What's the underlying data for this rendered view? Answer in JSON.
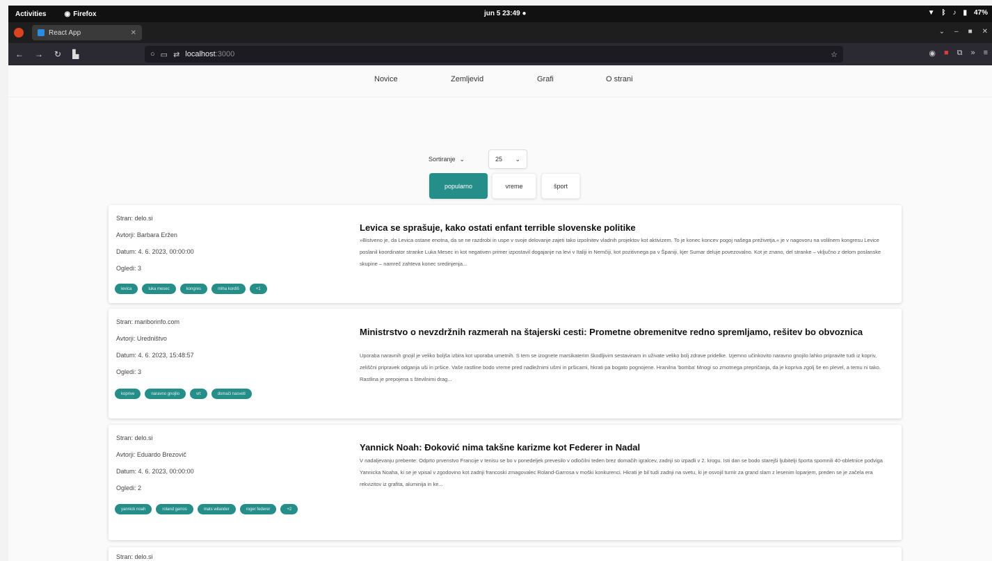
{
  "system": {
    "activities": "Activities",
    "app_name": "Firefox",
    "clock": "jun 5 23:49",
    "battery": "47%"
  },
  "browser": {
    "tab_title": "React App",
    "url_host": "localhost",
    "url_port": ":3000"
  },
  "nav": {
    "items": [
      "Novice",
      "Zemljevid",
      "Grafi",
      "O strani"
    ]
  },
  "controls": {
    "sort_label": "Sortiranje",
    "page_size": "25",
    "categories": [
      "popularno",
      "vreme",
      "šport"
    ]
  },
  "articles": [
    {
      "source": "Stran: delo.si",
      "author": "Avtorji: Barbara Eržen",
      "date": "Datum: 4. 6. 2023, 00:00:00",
      "views": "Ogledi: 3",
      "tags": [
        "levica",
        "luka mesec",
        "kongres",
        "miha kordiš",
        "+1"
      ],
      "title": "Levica se sprašuje, kako ostati enfant terrible slovenske politike",
      "summary": "»Bistveno je, da Levica ostane enotna, da se ne razdrobi in uspe v svoje delovanje zajeti tako izpolnitev vladnih projektov kot aktivizem. To je konec koncev pogoj našega preživetja.« je v nagovoru na volilnem kongresu Levice poslanil koordinator stranke Luka Mesec in kot negativen primer izpostavil dogajanje na levi v Italiji in Nemčiji, kot pozitivnega pa v Španiji, kjer Sumar deluje povezovalno. Kot je znano, del stranke – vključno z delom poslanske skupine – namreč zahteva konec sredinjenja..."
    },
    {
      "source": "Stran: mariborinfo.com",
      "author": "Avtorji: Uredništvo",
      "date": "Datum: 4. 6. 2023, 15:48:57",
      "views": "Ogledi: 3",
      "tags": [
        "koprive",
        "naravno gnojilo",
        "vrt",
        "domači nasveti"
      ],
      "title": "Ministrstvo o nevzdržnih razmerah na štajerski cesti: Prometne obremenitve redno spremljamo, rešitev bo obvoznica",
      "summary": "Uporaba naravnih gnojil je veliko boljša izbira kot uporaba umetnih. S tem se izognete marsikaterim škodljivim sestavinam in uživate veliko bolj zdrave pridelke. Izjemno učinkovito naravno gnojilo lahko pripravite tudi iz kopriv, zeliščni pripravek odganja uši in pršice. Vaše rastline bodo vreme pred nadležnimi ušmi in pršicami, hkrati pa bogato pognojene. Hranilna 'bomba' Mnogi so zmotnega prepričanja, da je kopriva zgolj še en plevel, a temu ni tako. Rastlina je prepojena s številnimi drag..."
    },
    {
      "source": "Stran: delo.si",
      "author": "Avtorji: Eduardo Brezovič",
      "date": "Datum: 4. 6. 2023, 00:00:00",
      "views": "Ogledi: 2",
      "tags": [
        "yannick noah",
        "roland garros",
        "mats wilander",
        "roger federer",
        "+2"
      ],
      "title": "Yannick Noah: Đoković nima takšne karizme kot Federer in Nadal",
      "summary": "V nadaljevanju prebente: Odprto prvenstvo Francije v tenisu se bo v ponedeljek prevesilo v odločilni teden brez domačih igralcev, zadnji so izpadli v 2. krogu. Isti dan se bodo starejši ljubitelji športa spomnili 40-obletnice podviga Yannicka Noaha, ki se je vpisal v zgodovino kot zadnji francoski zmagovalec Roland-Garrosa v moški konkurenci. Hkrati je bil tudi zadnji na svetu, ki je osvojil turnir za grand slam z lesenim loparjem, preden se je začela era rekvizitov iz grafita, aluminija in ke..."
    },
    {
      "source": "Stran: delo.si"
    }
  ]
}
